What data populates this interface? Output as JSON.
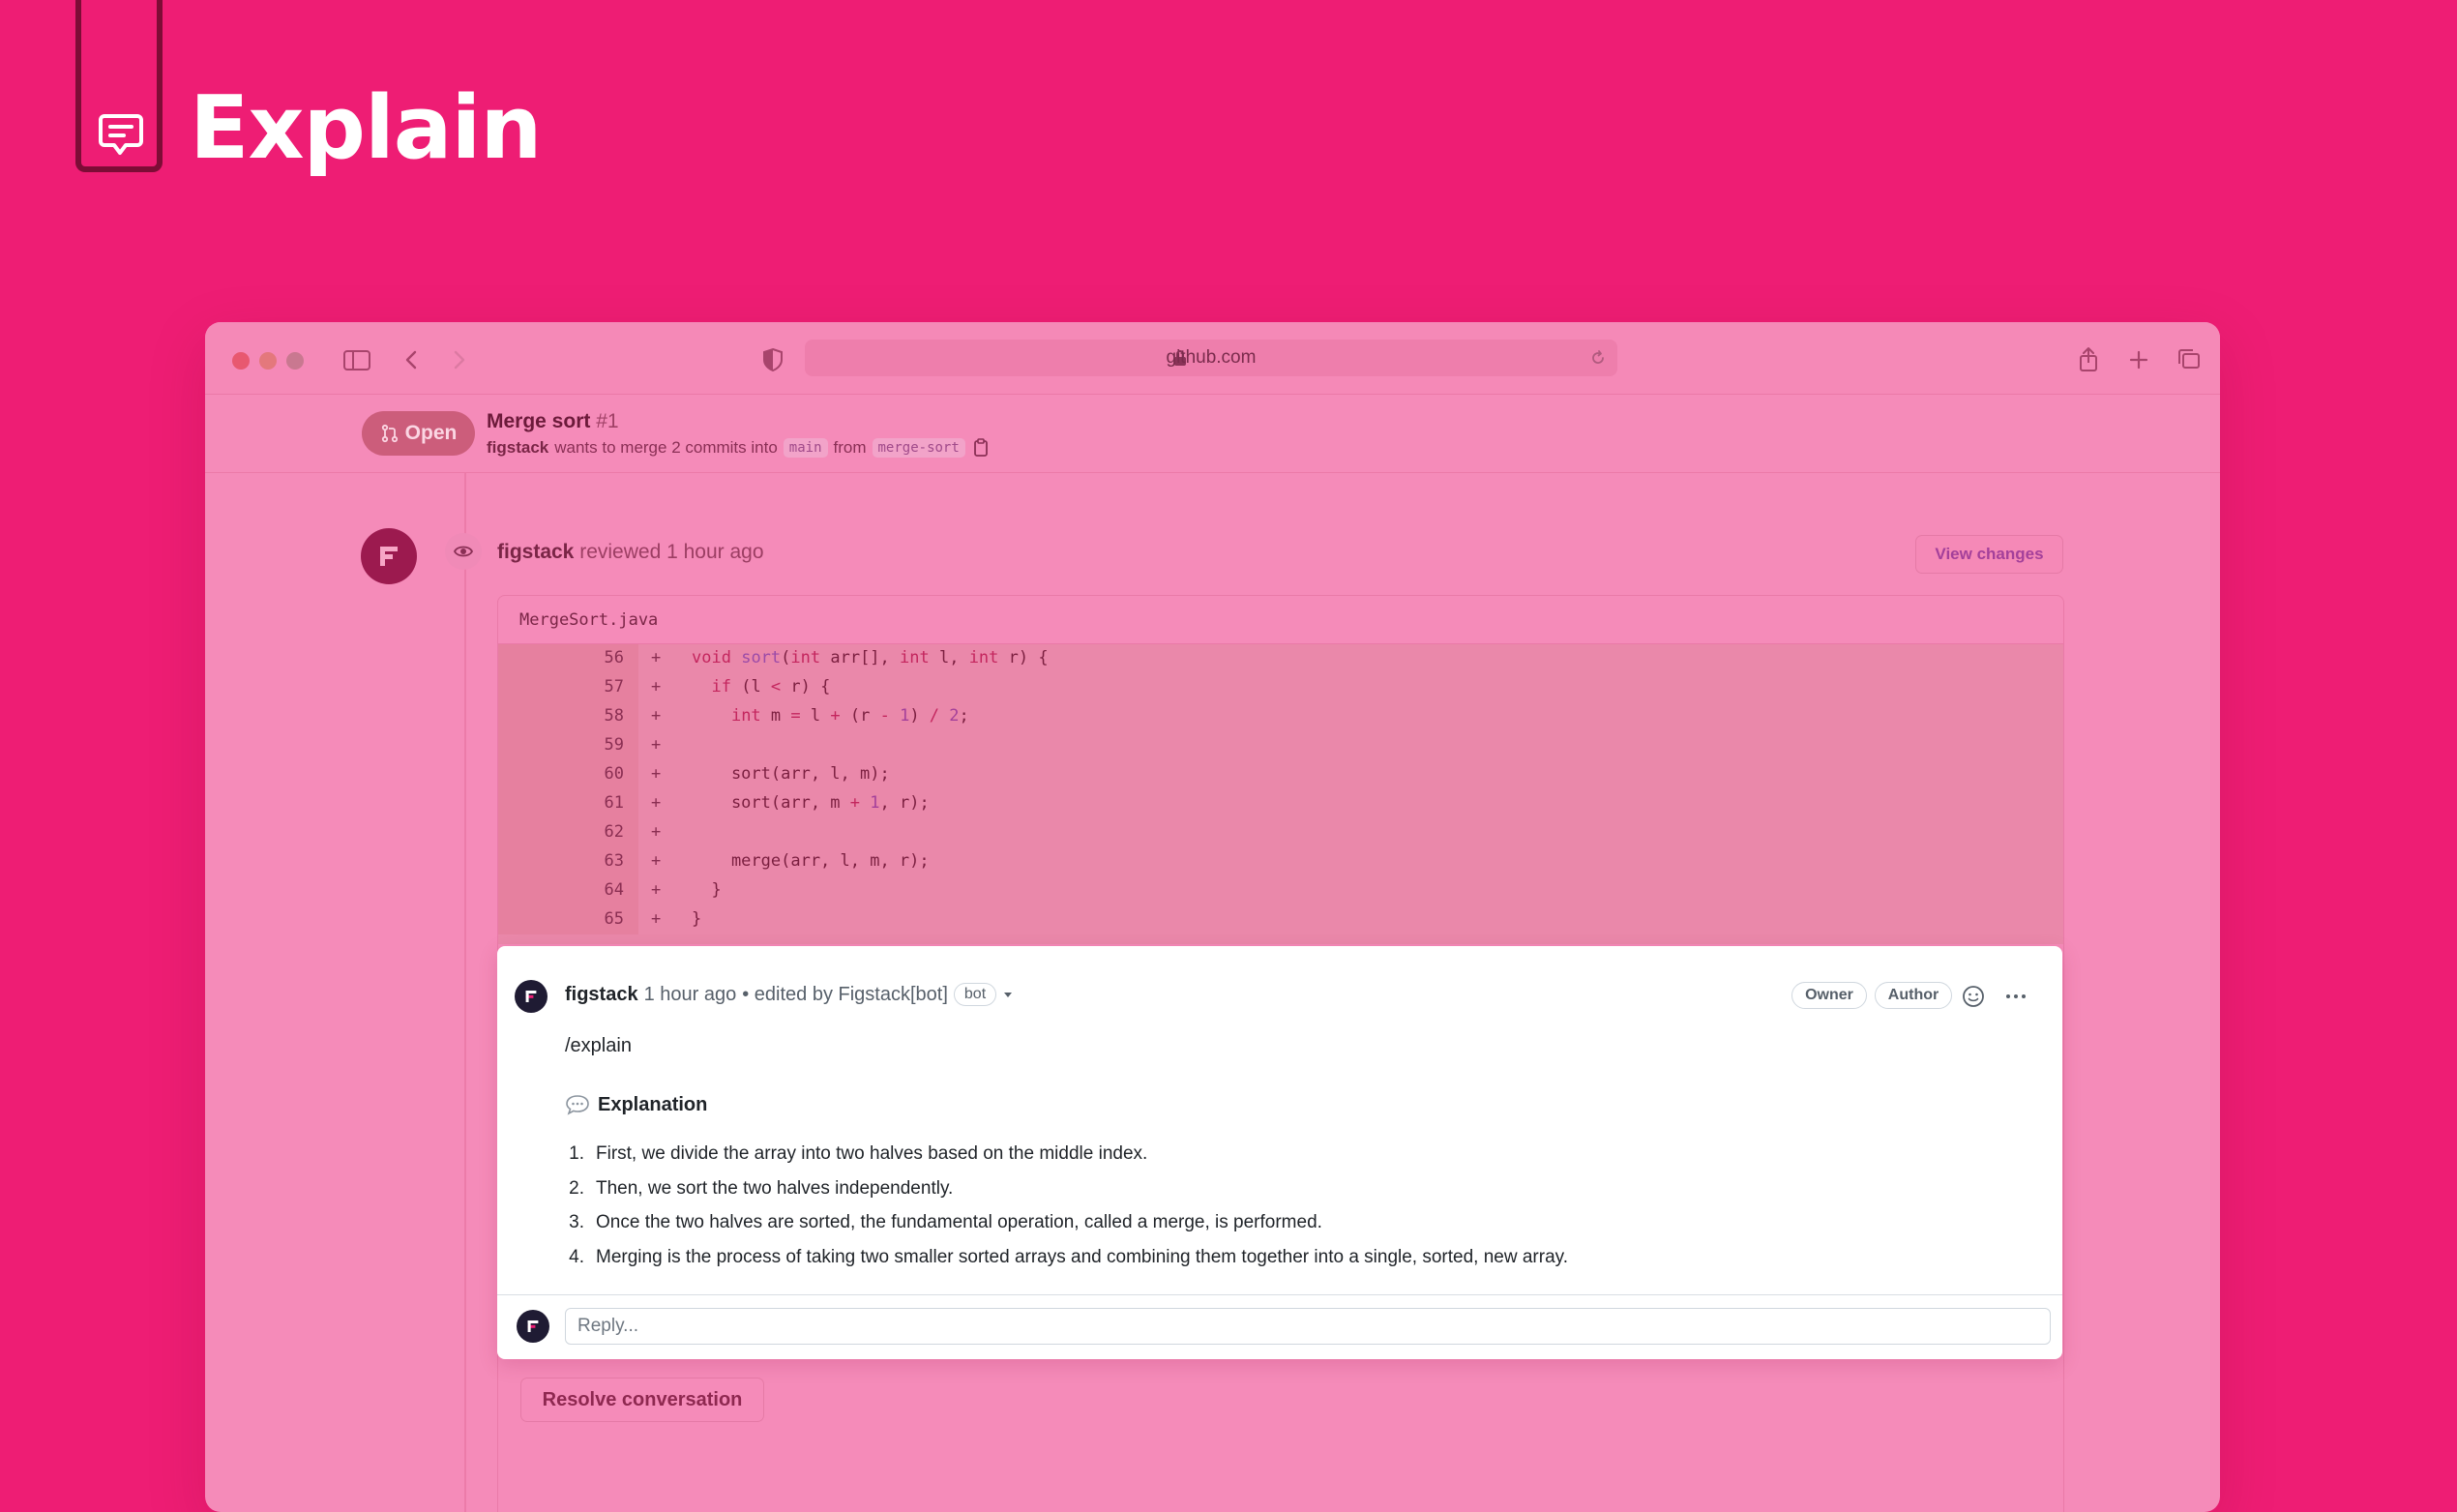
{
  "hero": {
    "title": "Explain"
  },
  "browser": {
    "url": "github.com"
  },
  "pr": {
    "status": "Open",
    "title": "Merge sort",
    "number": "#1",
    "author": "figstack",
    "meta_text": "wants to merge 2 commits into",
    "base_branch": "main",
    "from_text": "from",
    "head_branch": "merge-sort"
  },
  "review": {
    "user": "figstack",
    "action": "reviewed 1 hour ago",
    "view_changes_label": "View changes"
  },
  "file": {
    "name": "MergeSort.java",
    "lines": [
      {
        "n": "56",
        "sign": "+"
      },
      {
        "n": "57",
        "sign": "+"
      },
      {
        "n": "58",
        "sign": "+"
      },
      {
        "n": "59",
        "sign": "+"
      },
      {
        "n": "60",
        "sign": "+"
      },
      {
        "n": "61",
        "sign": "+"
      },
      {
        "n": "62",
        "sign": "+"
      },
      {
        "n": "63",
        "sign": "+"
      },
      {
        "n": "64",
        "sign": "+"
      },
      {
        "n": "65",
        "sign": "+"
      }
    ]
  },
  "comment": {
    "user": "figstack",
    "time": "1 hour ago",
    "edited": "• edited by Figstack[bot]",
    "bot_badge": "bot",
    "owner_label": "Owner",
    "author_label": "Author",
    "command": "/explain",
    "section_title": "Explanation",
    "items": [
      {
        "idx": "1.",
        "text": "First, we divide the array into two halves based on the middle index."
      },
      {
        "idx": "2.",
        "text": "Then, we sort the two halves independently."
      },
      {
        "idx": "3.",
        "text": "Once the two halves are sorted, the fundamental operation, called a merge, is performed."
      },
      {
        "idx": "4.",
        "text": "Merging is the process of taking two smaller sorted arrays and combining them together into a single, sorted, new array."
      }
    ],
    "reply_placeholder": "Reply..."
  },
  "resolve_label": "Resolve conversation",
  "colors": {
    "background": "#ee1d74",
    "window": "#f58bb9",
    "code_bg": "#ea88aa"
  }
}
